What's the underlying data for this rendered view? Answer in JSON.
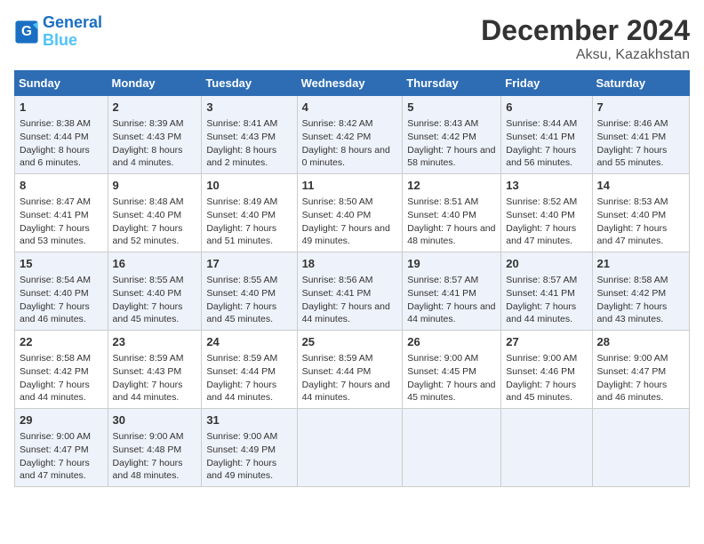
{
  "header": {
    "logo_line1": "General",
    "logo_line2": "Blue",
    "month": "December 2024",
    "location": "Aksu, Kazakhstan"
  },
  "weekdays": [
    "Sunday",
    "Monday",
    "Tuesday",
    "Wednesday",
    "Thursday",
    "Friday",
    "Saturday"
  ],
  "weeks": [
    [
      {
        "day": "1",
        "sunrise": "Sunrise: 8:38 AM",
        "sunset": "Sunset: 4:44 PM",
        "daylight": "Daylight: 8 hours and 6 minutes."
      },
      {
        "day": "2",
        "sunrise": "Sunrise: 8:39 AM",
        "sunset": "Sunset: 4:43 PM",
        "daylight": "Daylight: 8 hours and 4 minutes."
      },
      {
        "day": "3",
        "sunrise": "Sunrise: 8:41 AM",
        "sunset": "Sunset: 4:43 PM",
        "daylight": "Daylight: 8 hours and 2 minutes."
      },
      {
        "day": "4",
        "sunrise": "Sunrise: 8:42 AM",
        "sunset": "Sunset: 4:42 PM",
        "daylight": "Daylight: 8 hours and 0 minutes."
      },
      {
        "day": "5",
        "sunrise": "Sunrise: 8:43 AM",
        "sunset": "Sunset: 4:42 PM",
        "daylight": "Daylight: 7 hours and 58 minutes."
      },
      {
        "day": "6",
        "sunrise": "Sunrise: 8:44 AM",
        "sunset": "Sunset: 4:41 PM",
        "daylight": "Daylight: 7 hours and 56 minutes."
      },
      {
        "day": "7",
        "sunrise": "Sunrise: 8:46 AM",
        "sunset": "Sunset: 4:41 PM",
        "daylight": "Daylight: 7 hours and 55 minutes."
      }
    ],
    [
      {
        "day": "8",
        "sunrise": "Sunrise: 8:47 AM",
        "sunset": "Sunset: 4:41 PM",
        "daylight": "Daylight: 7 hours and 53 minutes."
      },
      {
        "day": "9",
        "sunrise": "Sunrise: 8:48 AM",
        "sunset": "Sunset: 4:40 PM",
        "daylight": "Daylight: 7 hours and 52 minutes."
      },
      {
        "day": "10",
        "sunrise": "Sunrise: 8:49 AM",
        "sunset": "Sunset: 4:40 PM",
        "daylight": "Daylight: 7 hours and 51 minutes."
      },
      {
        "day": "11",
        "sunrise": "Sunrise: 8:50 AM",
        "sunset": "Sunset: 4:40 PM",
        "daylight": "Daylight: 7 hours and 49 minutes."
      },
      {
        "day": "12",
        "sunrise": "Sunrise: 8:51 AM",
        "sunset": "Sunset: 4:40 PM",
        "daylight": "Daylight: 7 hours and 48 minutes."
      },
      {
        "day": "13",
        "sunrise": "Sunrise: 8:52 AM",
        "sunset": "Sunset: 4:40 PM",
        "daylight": "Daylight: 7 hours and 47 minutes."
      },
      {
        "day": "14",
        "sunrise": "Sunrise: 8:53 AM",
        "sunset": "Sunset: 4:40 PM",
        "daylight": "Daylight: 7 hours and 47 minutes."
      }
    ],
    [
      {
        "day": "15",
        "sunrise": "Sunrise: 8:54 AM",
        "sunset": "Sunset: 4:40 PM",
        "daylight": "Daylight: 7 hours and 46 minutes."
      },
      {
        "day": "16",
        "sunrise": "Sunrise: 8:55 AM",
        "sunset": "Sunset: 4:40 PM",
        "daylight": "Daylight: 7 hours and 45 minutes."
      },
      {
        "day": "17",
        "sunrise": "Sunrise: 8:55 AM",
        "sunset": "Sunset: 4:40 PM",
        "daylight": "Daylight: 7 hours and 45 minutes."
      },
      {
        "day": "18",
        "sunrise": "Sunrise: 8:56 AM",
        "sunset": "Sunset: 4:41 PM",
        "daylight": "Daylight: 7 hours and 44 minutes."
      },
      {
        "day": "19",
        "sunrise": "Sunrise: 8:57 AM",
        "sunset": "Sunset: 4:41 PM",
        "daylight": "Daylight: 7 hours and 44 minutes."
      },
      {
        "day": "20",
        "sunrise": "Sunrise: 8:57 AM",
        "sunset": "Sunset: 4:41 PM",
        "daylight": "Daylight: 7 hours and 44 minutes."
      },
      {
        "day": "21",
        "sunrise": "Sunrise: 8:58 AM",
        "sunset": "Sunset: 4:42 PM",
        "daylight": "Daylight: 7 hours and 43 minutes."
      }
    ],
    [
      {
        "day": "22",
        "sunrise": "Sunrise: 8:58 AM",
        "sunset": "Sunset: 4:42 PM",
        "daylight": "Daylight: 7 hours and 44 minutes."
      },
      {
        "day": "23",
        "sunrise": "Sunrise: 8:59 AM",
        "sunset": "Sunset: 4:43 PM",
        "daylight": "Daylight: 7 hours and 44 minutes."
      },
      {
        "day": "24",
        "sunrise": "Sunrise: 8:59 AM",
        "sunset": "Sunset: 4:44 PM",
        "daylight": "Daylight: 7 hours and 44 minutes."
      },
      {
        "day": "25",
        "sunrise": "Sunrise: 8:59 AM",
        "sunset": "Sunset: 4:44 PM",
        "daylight": "Daylight: 7 hours and 44 minutes."
      },
      {
        "day": "26",
        "sunrise": "Sunrise: 9:00 AM",
        "sunset": "Sunset: 4:45 PM",
        "daylight": "Daylight: 7 hours and 45 minutes."
      },
      {
        "day": "27",
        "sunrise": "Sunrise: 9:00 AM",
        "sunset": "Sunset: 4:46 PM",
        "daylight": "Daylight: 7 hours and 45 minutes."
      },
      {
        "day": "28",
        "sunrise": "Sunrise: 9:00 AM",
        "sunset": "Sunset: 4:47 PM",
        "daylight": "Daylight: 7 hours and 46 minutes."
      }
    ],
    [
      {
        "day": "29",
        "sunrise": "Sunrise: 9:00 AM",
        "sunset": "Sunset: 4:47 PM",
        "daylight": "Daylight: 7 hours and 47 minutes."
      },
      {
        "day": "30",
        "sunrise": "Sunrise: 9:00 AM",
        "sunset": "Sunset: 4:48 PM",
        "daylight": "Daylight: 7 hours and 48 minutes."
      },
      {
        "day": "31",
        "sunrise": "Sunrise: 9:00 AM",
        "sunset": "Sunset: 4:49 PM",
        "daylight": "Daylight: 7 hours and 49 minutes."
      },
      null,
      null,
      null,
      null
    ]
  ]
}
